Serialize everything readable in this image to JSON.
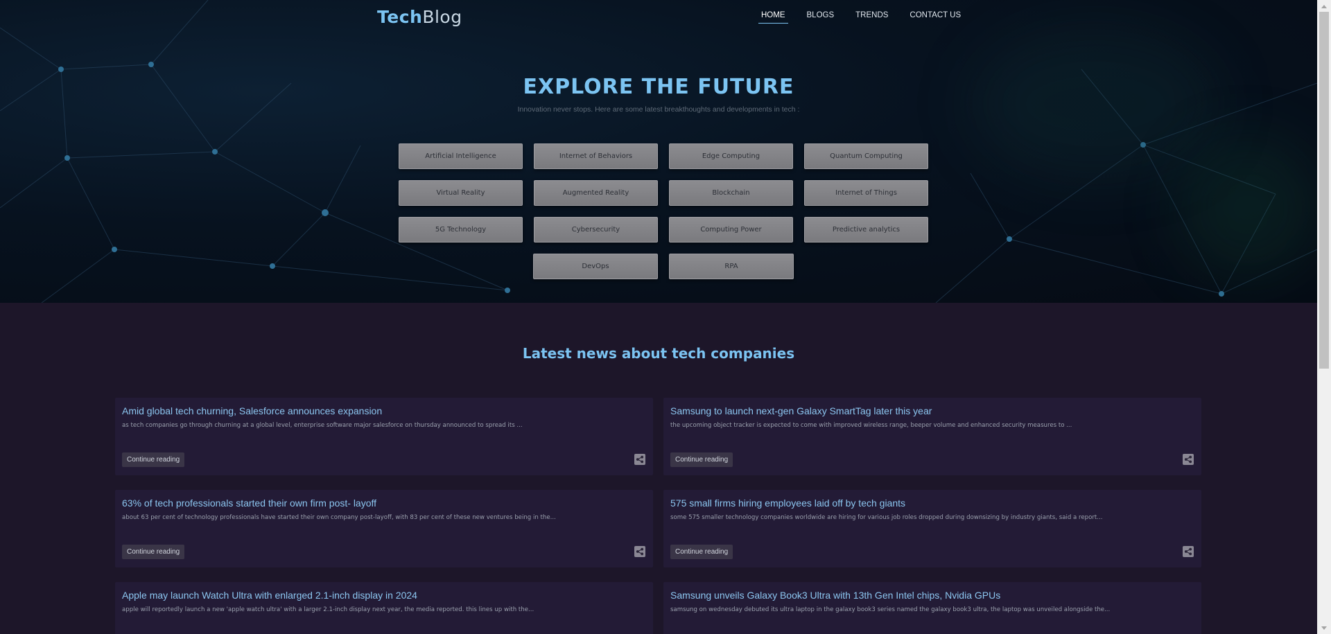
{
  "header": {
    "logo_part1": "Tech",
    "logo_part2": "Blog",
    "nav": [
      "HOME",
      "BLOGS",
      "TRENDS",
      "CONTACT US"
    ],
    "active_nav": "HOME"
  },
  "hero": {
    "title": "EXPLORE THE FUTURE",
    "subtitle": "Innovation never stops. Here are some latest breakthoughts and developments in tech :",
    "topics": [
      [
        "Artificial Intelligence",
        "Internet of Behaviors",
        "Edge Computing",
        "Quantum Computing"
      ],
      [
        "Virtual Reality",
        "Augmented Reality",
        "Blockchain",
        "Internet of Things"
      ],
      [
        "5G Technology",
        "Cybersecurity",
        "Computing Power",
        "Predictive analytics"
      ],
      [
        "DevOps",
        "RPA"
      ]
    ]
  },
  "news": {
    "title": "Latest news about tech companies",
    "button_label": "Continue reading",
    "share_icon": "share-icon",
    "cards": [
      {
        "title": "Amid global tech churning, Salesforce announces expansion",
        "excerpt": "as tech companies go through churning at a global level, enterprise software major salesforce on thursday announced to spread its ..."
      },
      {
        "title": "Samsung to launch next-gen Galaxy SmartTag later this year",
        "excerpt": "the upcoming object tracker is expected to come with improved wireless range, beeper volume and enhanced security measures to ..."
      },
      {
        "title": "63% of tech professionals started their own firm post- layoff",
        "excerpt": "about 63 per cent of technology professionals have started their own company post-layoff, with 83 per cent of these new ventures being in the..."
      },
      {
        "title": "575 small firms hiring employees laid off by tech giants",
        "excerpt": "some 575 smaller technology companies worldwide are hiring for various job roles dropped during downsizing by industry giants, said a report..."
      },
      {
        "title": "Apple may launch Watch Ultra with enlarged 2.1-inch display in 2024",
        "excerpt": "apple will reportedly launch a new 'apple watch ultra' with a larger 2.1-inch display next year, the media reported. this lines up with the..."
      },
      {
        "title": "Samsung unveils Galaxy Book3 Ultra with 13th Gen Intel chips, Nvidia GPUs",
        "excerpt": "samsung on wednesday debuted its ultra laptop in the galaxy book3 series named the galaxy book3 ultra, the laptop was unveiled alongside the..."
      }
    ]
  },
  "colors": {
    "accent": "#7cc4f2",
    "hero_bg": "#050b14",
    "news_bg": "#1d1629",
    "card_bg": "#231b36",
    "topic_bg": "#828286"
  }
}
